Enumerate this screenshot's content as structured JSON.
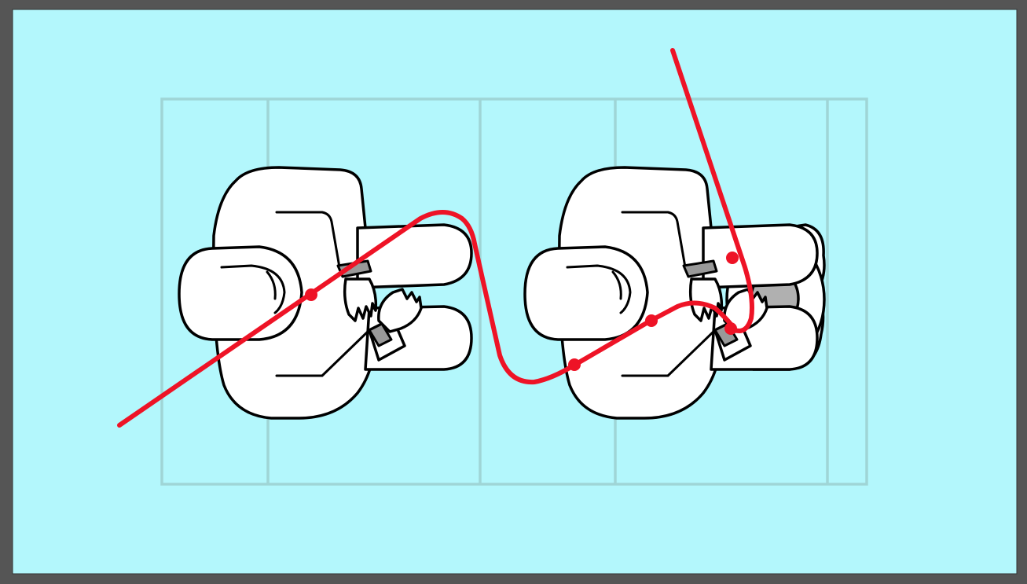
{
  "colors": {
    "frame": "#555555",
    "background": "#B3F7FC",
    "grid": "#9FD5D6",
    "figure_fill": "#FFFFFF",
    "outline": "#000000",
    "cuff": "#999999",
    "object": "#B0B0B0",
    "path": "#EE1326"
  },
  "figures": [
    {
      "name": "left-person",
      "icon": "person-topdown-icon",
      "holds_object": false
    },
    {
      "name": "right-person",
      "icon": "person-topdown-icon",
      "holds_object": true,
      "object_icon": "round-object-icon"
    }
  ],
  "path": {
    "icon": "route-line",
    "marker_count": 4
  }
}
